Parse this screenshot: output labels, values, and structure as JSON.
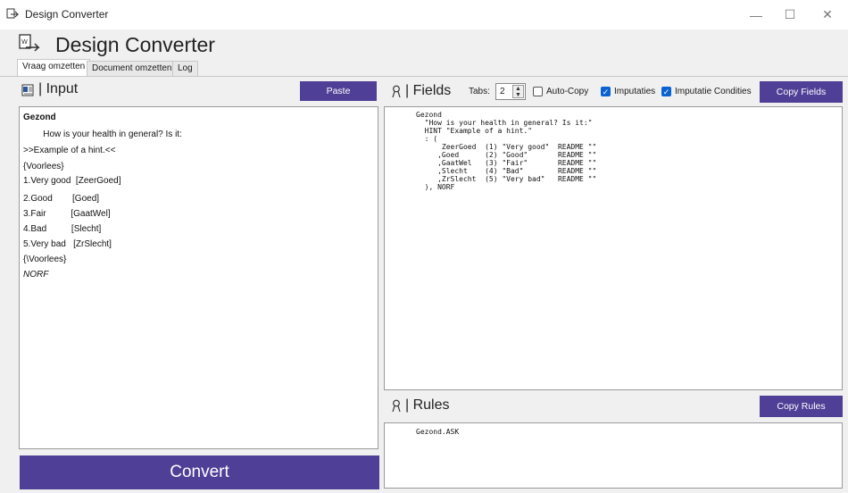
{
  "window": {
    "title": "Design Converter",
    "minimize": "—",
    "maximize": "☐",
    "close": "✕"
  },
  "header": {
    "title": "Design Converter"
  },
  "tabs": [
    {
      "label": "Vraag omzetten",
      "active": true
    },
    {
      "label": "Document omzetten",
      "active": false
    },
    {
      "label": "Log",
      "active": false
    }
  ],
  "input_panel": {
    "title": "| Input",
    "paste_label": "Paste",
    "lines": [
      "Gezond",
      "        How is your health in general? Is it:",
      ">>Example of a hint.<<",
      "{Voorlees}",
      "1.Very good  [ZeerGoed]",
      "2.Good        [Goed]",
      "3.Fair          [GaatWel]",
      "4.Bad          [Slecht]",
      "5.Very bad   [ZrSlecht]",
      "{\\Voorlees}",
      "NORF"
    ],
    "convert_label": "Convert"
  },
  "fields_panel": {
    "title": "| Fields",
    "tabs_label": "Tabs:",
    "tabs_value": "2",
    "autocopy_label": "Auto-Copy",
    "autocopy_checked": false,
    "imputaties_label": "Imputaties",
    "imputaties_checked": true,
    "imputatie_condities_label": "Imputatie Condities",
    "imputatie_condities_checked": true,
    "copy_label": "Copy Fields",
    "output": "Gezond\n  \"How is your health in general? Is it:\"\n  HINT \"Example of a hint.\"\n  : (\n      ZeerGoed  (1) \"Very good\"  README \"\"\n     ,Goed      (2) \"Good\"       README \"\"\n     ,GaatWel   (3) \"Fair\"       README \"\"\n     ,Slecht    (4) \"Bad\"        README \"\"\n     ,ZrSlecht  (5) \"Very bad\"   README \"\"\n  ), NORF"
  },
  "rules_panel": {
    "title": "| Rules",
    "copy_label": "Copy Rules",
    "output": "Gezond.ASK"
  },
  "colors": {
    "accent": "#4f3f96",
    "checkbox": "#0a62d0"
  }
}
